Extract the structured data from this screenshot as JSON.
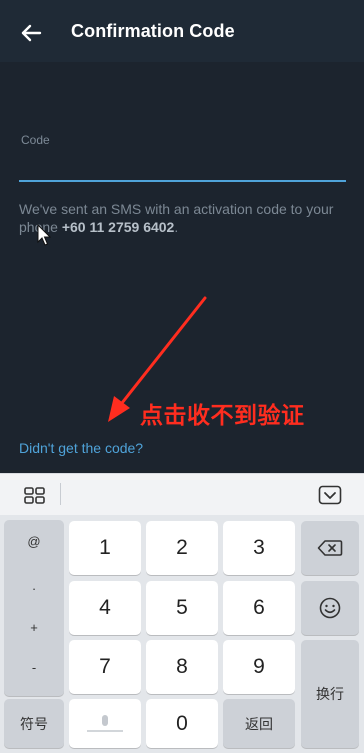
{
  "header": {
    "title": "Confirmation Code"
  },
  "form": {
    "code_label": "Code",
    "code_value": "",
    "sms_text": "We've sent an SMS with an activation code to your phone",
    "phone": "+60 11 2759 6402"
  },
  "annotation": {
    "text": "点击收不到验证",
    "color": "#ff2d1f"
  },
  "link": {
    "didnt_get": "Didn't get the code?"
  },
  "keyboard": {
    "symbols": [
      "@",
      ".",
      "+",
      "-"
    ],
    "digits": [
      "1",
      "2",
      "3",
      "4",
      "5",
      "6",
      "7",
      "8",
      "9",
      "0"
    ],
    "symbol_key": "符号",
    "back_key": "返回",
    "newline_key": "换行"
  },
  "colors": {
    "accent": "#4fa3d9",
    "background": "#1c242e",
    "header": "#1f2a36"
  }
}
